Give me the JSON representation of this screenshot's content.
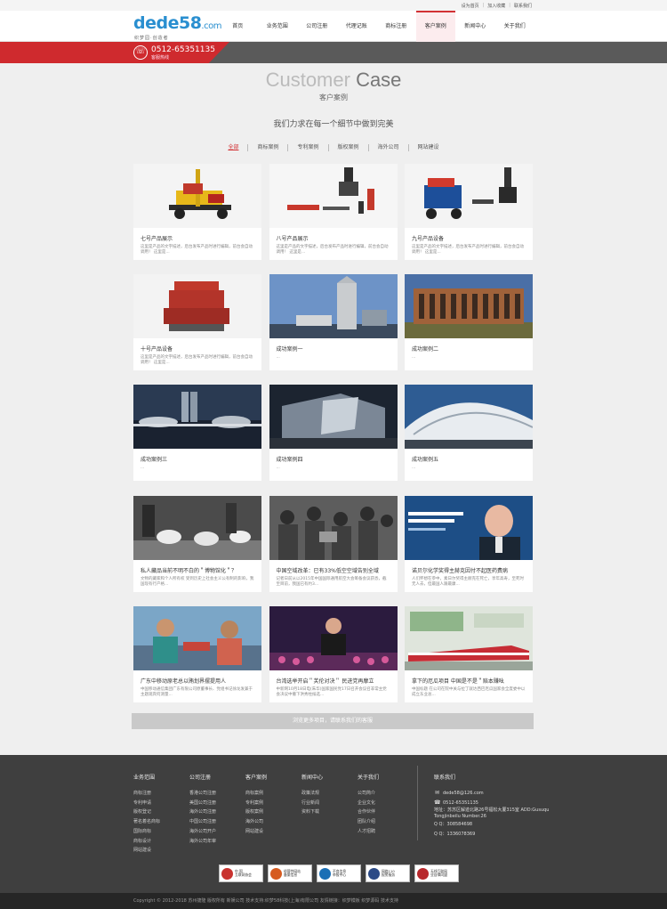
{
  "topbar": {
    "links": [
      "设为首页",
      "加入收藏",
      "联系我们"
    ]
  },
  "logo": {
    "main": "dede58",
    "suffix": ".com",
    "sub": "织梦园·创造者"
  },
  "nav": {
    "items": [
      "首页",
      "业务范围",
      "公司注册",
      "代理记账",
      "商标注册",
      "客户案例",
      "新闻中心",
      "关于我们"
    ],
    "active_index": 5
  },
  "hotline": {
    "number": "0512-65351135",
    "label": "客服热线"
  },
  "hero": {
    "en_light": "Customer",
    "en_dark": "Case",
    "cn": "客户案例",
    "slogan": "我们力求在每一个细节中做到完美"
  },
  "filters": [
    "全部",
    "商标案例",
    "专利案例",
    "版权案例",
    "海外公司",
    "网站建设"
  ],
  "active_filter": 0,
  "cases": [
    {
      "title": "七号产品展示",
      "desc": "这里是产品的文字描述，后台发布产品时进行编辑，前台会自动调用！ 这里是..."
    },
    {
      "title": "八号产品展示",
      "desc": "这里是产品的文字描述，后台发布产品时进行编辑，前台会自动调用！ 这里是..."
    },
    {
      "title": "九号产品设备",
      "desc": "这里是产品的文字描述，后台发布产品时进行编辑，前台会自动调用！ 这里是..."
    },
    {
      "title": "十号产品设备",
      "desc": "这里是产品的文字描述，后台发布产品时进行编辑，前台会自动调用！ 这里是..."
    },
    {
      "title": "成功案例一",
      "desc": "..."
    },
    {
      "title": "成功案例二",
      "desc": "..."
    },
    {
      "title": "成功案例三",
      "desc": "..."
    },
    {
      "title": "成功案例四",
      "desc": "..."
    },
    {
      "title": "成功案例五",
      "desc": "..."
    },
    {
      "title": "私人藏品当前不明不白的＂博物馆化＂？",
      "desc": "文物的藏家和个人所有权 受到历史上社会主义公有制的影响，我国现有行产格..."
    },
    {
      "title": "中国空域改革：已有33%低空空域告别全域",
      "desc": "记者日前从以2015年中国国际通用航空大会筹备会议获悉，截至目前，我国已有约3..."
    },
    {
      "title": "诺贝尔化学奖得主赫克因付不起医药费病",
      "desc": "人们怀想在参中，素日尔奖得主赫克在死亡，享年高寿，至死时无人去，但最国人跟最康..."
    },
    {
      "title": "广东中移动原老总以贿划界摆提用人",
      "desc": "中国移动通信集团广东有限公司原董事长、党组书记徐龙发兼于主题观宾何测量..."
    },
    {
      "title": "台湾选举开启＂芙伦对决＂ 民进党再摩立",
      "desc": "中新网10月18日电(朱华)国家国民党17日召开会议召非常主党会决议中撤下洪秀柱候选..."
    },
    {
      "title": "拿下的厄瓜项目 中国是不是＂赔本赚吆",
      "desc": "中国标题 在公司在院中关与拉丁就达西巴厄瓜国家会全度委中以成立东业总..."
    }
  ],
  "more_text": "浏览更多项目，请联系我们的客服",
  "footer": {
    "columns": [
      {
        "heading": "业务范围",
        "links": [
          "商标注册",
          "专利申请",
          "版权登记",
          "著名着名商标",
          "国际商标",
          "商标设计",
          "网站建设"
        ]
      },
      {
        "heading": "公司注册",
        "links": [
          "香港公司注册",
          "美国公司注册",
          "海外公司注册",
          "中国公司注册",
          "海外公司开户",
          "海外公司年审"
        ]
      },
      {
        "heading": "客户案例",
        "links": [
          "商标案例",
          "专利案例",
          "版权案例",
          "海外公司",
          "网站建设"
        ]
      },
      {
        "heading": "新闻中心",
        "links": [
          "政策法规",
          "行业新闻",
          "资料下载"
        ]
      },
      {
        "heading": "关于我们",
        "links": [
          "公司简介",
          "企业文化",
          "合作伙伴",
          "团队介绍",
          "人才招聘"
        ]
      }
    ],
    "contact": {
      "heading": "联系我们",
      "email": "dede58@126.com",
      "phone": "0512-65351135",
      "address": "地址：苏苏区解迹北路26号福松大厦315室 ADD:Gusuqu Tongjinbeilu Number.26",
      "qq1": "Q Q：308584698",
      "qq2": "Q Q：1336078369"
    },
    "badges": [
      {
        "t1": "中 国",
        "t2": "互联网协会",
        "color": "#c8332f"
      },
      {
        "t1": "经营性网站",
        "t2": "备案信息",
        "color": "#d65b1f"
      },
      {
        "t1": "不良信息",
        "t2": "举报中心",
        "color": "#1a6fb5"
      },
      {
        "t1": "网络110",
        "t2": "报警服务",
        "color": "#2b4a86"
      },
      {
        "t1": "无线互联网",
        "t2": "业自律同盟",
        "color": "#b8282c"
      }
    ],
    "copyright": "Copyright © 2012-2018 苏州捷隆 版权所有  新娱公司  技术支持:织梦58科技(上海)有限公司  友情链接：织梦模板  织梦源码  技术支持"
  }
}
